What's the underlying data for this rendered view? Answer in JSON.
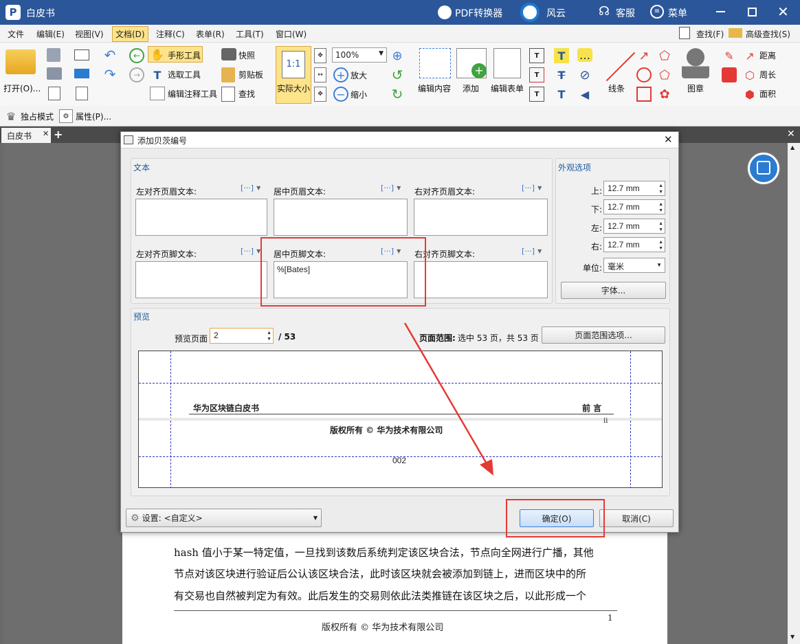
{
  "app": {
    "title": "白皮书",
    "pdf_converter": "PDF转换器",
    "cloud": "风云",
    "service": "客服",
    "menu": "菜单"
  },
  "menubar": [
    "文件",
    "编辑(E)",
    "视图(V)",
    "文档(D)",
    "注释(C)",
    "表单(R)",
    "工具(T)",
    "窗口(W)"
  ],
  "menubar_right": {
    "find": "查找(F)",
    "advanced_find": "高级查找(S)"
  },
  "toolbar": {
    "open": "打开(O)...",
    "hand_tool": "手形工具",
    "select_tool": "选取工具",
    "edit_annot_tool": "编辑注释工具",
    "snapshot": "快照",
    "clipboard": "剪贴板",
    "find": "查找",
    "actual_size": "实际大小",
    "zoom_value": "100%",
    "zoom_in": "放大",
    "zoom_out": "缩小",
    "edit_content": "编辑内容",
    "add": "添加",
    "edit_form": "编辑表单",
    "lines": "线条",
    "stamp": "图章",
    "distance": "距离",
    "perimeter": "周长",
    "area": "面积",
    "exclusive_mode": "独占模式",
    "properties": "属性(P)..."
  },
  "tab": {
    "label": "白皮书"
  },
  "document": {
    "lines": [
      "hash 值小于某一特定值，一旦找到该数后系统判定该区块合法，节点向全网进行广播，其他",
      "节点对该区块进行验证后公认该区块合法，此时该区块就会被添加到链上，进而区块中的所",
      "有交易也自然被判定为有效。此后发生的交易则依此法类推链在该区块之后，以此形成一个"
    ],
    "page_number": "1",
    "footer": "版权所有 © 华为技术有限公司"
  },
  "dialog": {
    "title": "添加贝茨编号",
    "text_group": "文本",
    "left_header": "左对齐页眉文本:",
    "center_header": "居中页眉文本:",
    "right_header": "右对齐页眉文本:",
    "left_footer": "左对齐页脚文本:",
    "center_footer": "居中页脚文本:",
    "right_footer": "右对齐页脚文本:",
    "center_footer_value": "%[Bates]",
    "macro": "[···]",
    "appearance": "外观选项",
    "top": "上:",
    "bottom": "下:",
    "left": "左:",
    "right": "右:",
    "margin_top": "12.7 mm",
    "margin_bottom": "12.7 mm",
    "margin_left": "12.7 mm",
    "margin_right": "12.7 mm",
    "unit_label": "单位:",
    "unit_value": "毫米",
    "font_button": "字体...",
    "preview_group": "预览",
    "preview_page_label": "预览页面",
    "preview_page_value": "2",
    "preview_total": "/ 53",
    "page_range_label": "页面范围:",
    "page_range_text": "选中 53 页，共 53 页",
    "page_range_button": "页面范围选项...",
    "preview": {
      "header_left": "华为区块链白皮书",
      "header_right": "前 言",
      "roman": "ii",
      "copyright": "版权所有 © 华为技术有限公司",
      "bates": "002"
    },
    "settings_label": "设置:",
    "settings_value": "<自定义>",
    "ok": "确定(O)",
    "cancel": "取消(C)"
  }
}
